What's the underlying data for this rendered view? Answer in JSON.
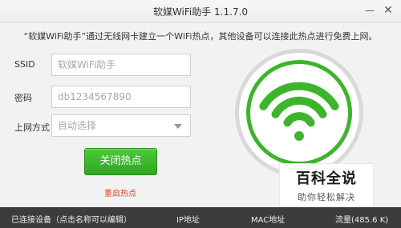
{
  "window": {
    "title": "软媒WiFi助手 1.1.7.0",
    "minimize_glyph": "—",
    "close_glyph": "✕"
  },
  "description": "“软媒WiFi助手”通过无线网卡建立一个WiFi热点，其他设备可以连接此热点进行免费上网。",
  "form": {
    "ssid": {
      "label": "SSID",
      "placeholder": "软媒WiFi助手"
    },
    "password": {
      "label": "密码",
      "placeholder": "db1234567890"
    },
    "network_mode": {
      "label": "上网方式",
      "selected": "自动选择"
    }
  },
  "actions": {
    "toggle_hotspot_label": "关闭热点",
    "restart_hotspot_label": "重启热点"
  },
  "status_icon": "wifi-icon",
  "watermark": {
    "title": "百科全说",
    "subtitle": "助你轻松解决"
  },
  "statusbar": {
    "connected_devices": "已连接设备（点击名称可以编辑）",
    "ip_header": "IP地址",
    "mac_header": "MAC地址",
    "traffic": "流量(485.6 K)"
  },
  "colors": {
    "accent_green": "#3db42c",
    "restart_link": "#d44a26",
    "statusbar_bg": "#3c3c3c"
  }
}
